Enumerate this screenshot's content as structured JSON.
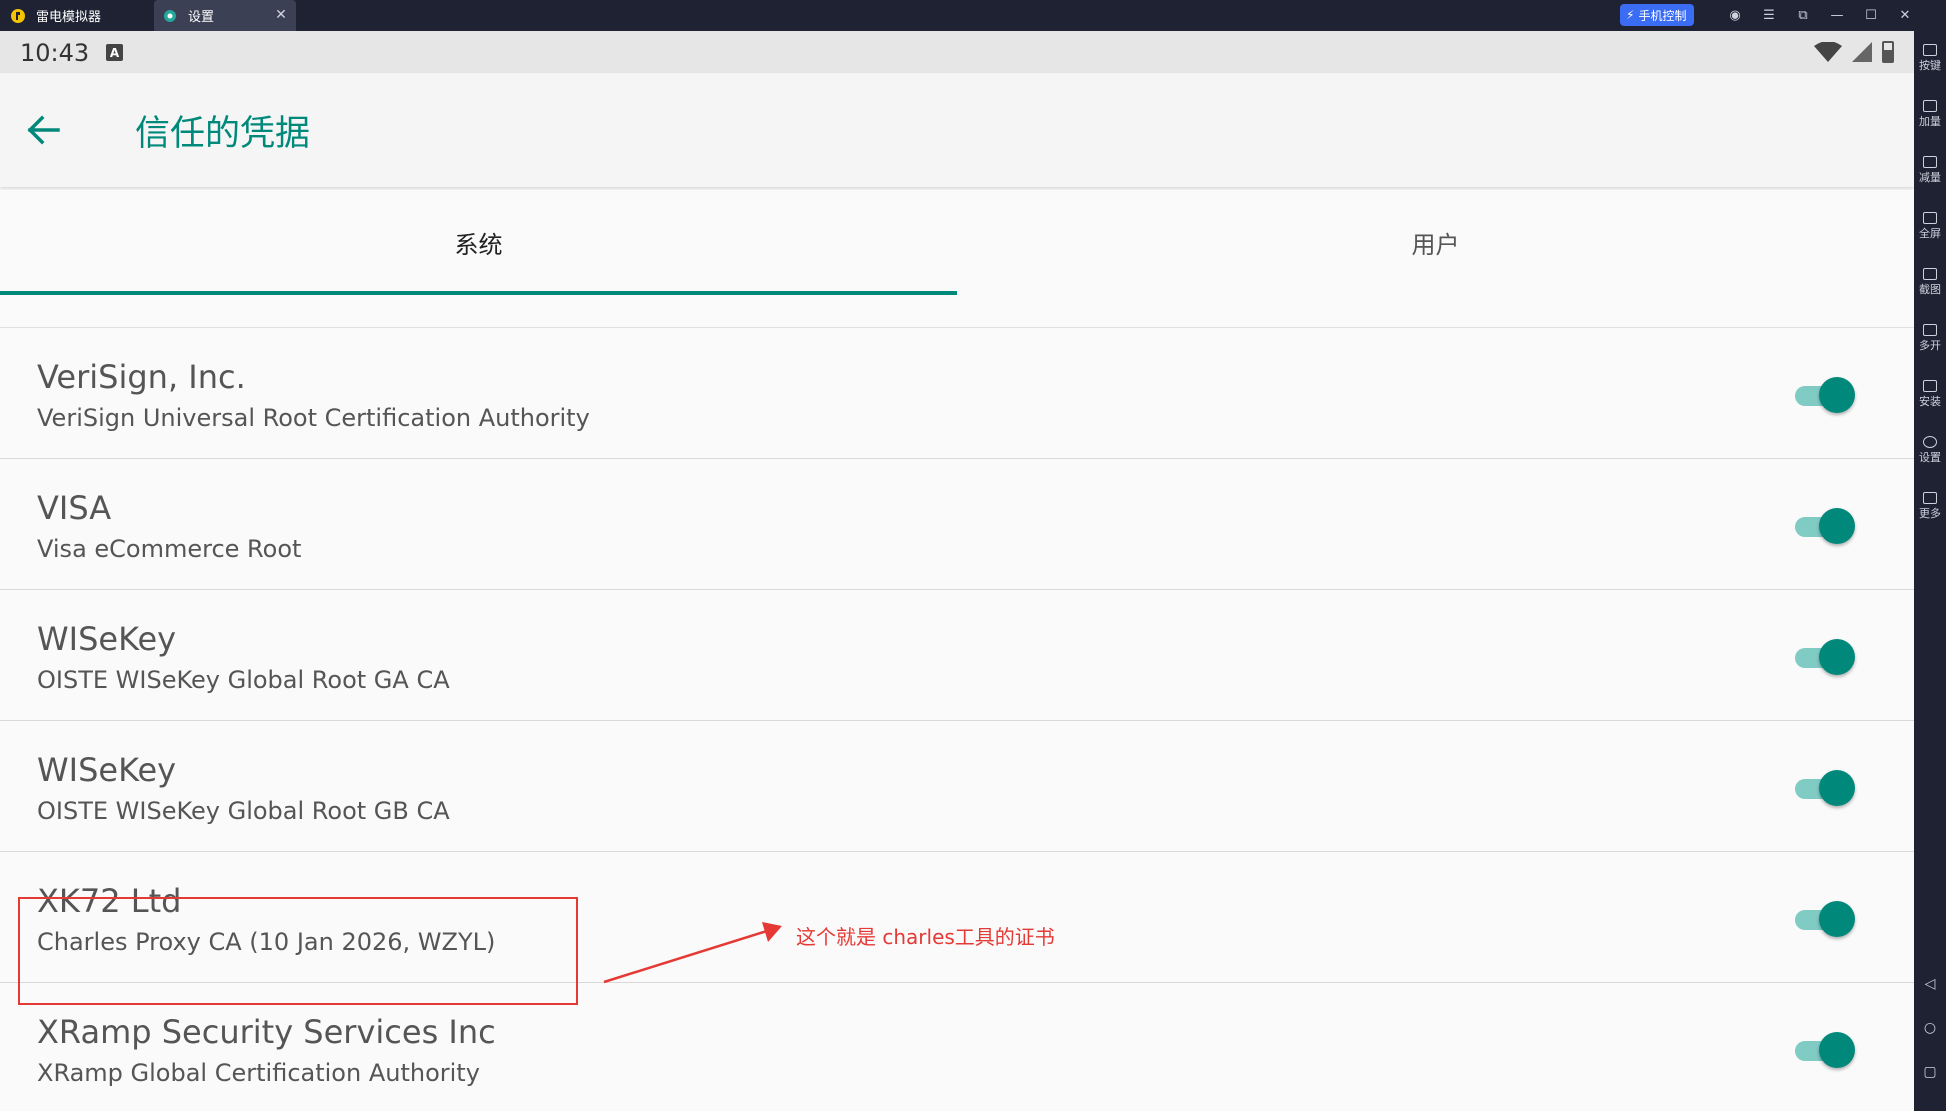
{
  "titlebar": {
    "app_tab": "雷电模拟器",
    "settings_tab": "设置",
    "phone_control": "手机控制"
  },
  "sidebar_tools": [
    "按键",
    "加量",
    "减量",
    "全屏",
    "截图",
    "多开",
    "安装",
    "设置",
    "更多"
  ],
  "statusbar": {
    "time": "10:43",
    "ime": "A"
  },
  "appbar": {
    "title": "信任的凭据"
  },
  "tabs": [
    {
      "label": "系统",
      "selected": true
    },
    {
      "label": "用户",
      "selected": false
    }
  ],
  "certificates": [
    {
      "org": "VeriSign, Inc.",
      "name": "VeriSign Universal Root Certification Authority",
      "enabled": true
    },
    {
      "org": "VISA",
      "name": "Visa eCommerce Root",
      "enabled": true
    },
    {
      "org": "WISeKey",
      "name": "OISTE WISeKey Global Root GA CA",
      "enabled": true
    },
    {
      "org": "WISeKey",
      "name": "OISTE WISeKey Global Root GB CA",
      "enabled": true
    },
    {
      "org": "XK72 Ltd",
      "name": "Charles Proxy CA (10 Jan 2026, WZYL)",
      "enabled": true
    },
    {
      "org": "XRamp Security Services Inc",
      "name": "XRamp Global Certification Authority",
      "enabled": true
    }
  ],
  "annotation": {
    "text": "这个就是 charles工具的证书",
    "color": "#e53935"
  },
  "colors": {
    "accent": "#00897b",
    "switch_track": "#80cbc4",
    "annotation": "#e53935"
  }
}
